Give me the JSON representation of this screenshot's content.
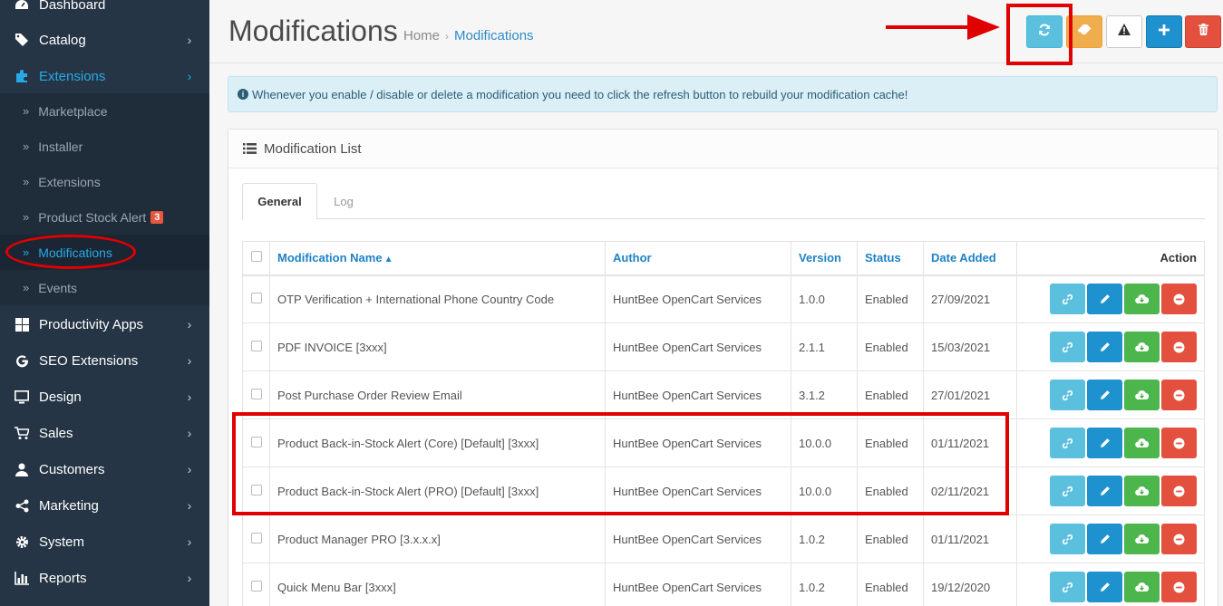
{
  "sidebar": {
    "items": [
      {
        "label": "Dashboard",
        "icon": "dashboard-icon"
      },
      {
        "label": "Catalog",
        "icon": "tags-icon"
      },
      {
        "label": "Extensions",
        "icon": "puzzle-icon"
      },
      {
        "label": "Productivity Apps",
        "icon": "windows-icon"
      },
      {
        "label": "SEO Extensions",
        "icon": "google-icon"
      },
      {
        "label": "Design",
        "icon": "monitor-icon"
      },
      {
        "label": "Sales",
        "icon": "cart-icon"
      },
      {
        "label": "Customers",
        "icon": "user-icon"
      },
      {
        "label": "Marketing",
        "icon": "share-icon"
      },
      {
        "label": "System",
        "icon": "gear-icon"
      },
      {
        "label": "Reports",
        "icon": "bar-chart-icon"
      }
    ],
    "submenu": [
      {
        "label": "Marketplace"
      },
      {
        "label": "Installer"
      },
      {
        "label": "Extensions"
      },
      {
        "label": "Product Stock Alert",
        "badge": "3"
      },
      {
        "label": "Modifications"
      },
      {
        "label": "Events"
      }
    ]
  },
  "header": {
    "title": "Modifications",
    "breadcrumb": [
      "Home",
      "Modifications"
    ],
    "separator": "›"
  },
  "alert": {
    "text": "Whenever you enable / disable or delete a modification you need to click the refresh button to rebuild your modification cache!"
  },
  "panel": {
    "title": "Modification List",
    "tabs": [
      "General",
      "Log"
    ]
  },
  "table": {
    "columns": [
      "Modification Name",
      "Author",
      "Version",
      "Status",
      "Date Added",
      "Action"
    ],
    "rows": [
      {
        "name": "OTP Verification + International Phone Country Code",
        "author": "HuntBee OpenCart Services",
        "version": "1.0.0",
        "status": "Enabled",
        "date": "27/09/2021"
      },
      {
        "name": "PDF INVOICE [3xxx]",
        "author": "HuntBee OpenCart Services",
        "version": "2.1.1",
        "status": "Enabled",
        "date": "15/03/2021"
      },
      {
        "name": "Post Purchase Order Review Email",
        "author": "HuntBee OpenCart Services",
        "version": "3.1.2",
        "status": "Enabled",
        "date": "27/01/2021"
      },
      {
        "name": "Product Back-in-Stock Alert (Core) [Default] [3xxx]",
        "author": "HuntBee OpenCart Services",
        "version": "10.0.0",
        "status": "Enabled",
        "date": "01/11/2021"
      },
      {
        "name": "Product Back-in-Stock Alert (PRO) [Default] [3xxx]",
        "author": "HuntBee OpenCart Services",
        "version": "10.0.0",
        "status": "Enabled",
        "date": "02/11/2021"
      },
      {
        "name": "Product Manager PRO [3.x.x.x]",
        "author": "HuntBee OpenCart Services",
        "version": "1.0.2",
        "status": "Enabled",
        "date": "01/11/2021"
      },
      {
        "name": "Quick Menu Bar [3xxx]",
        "author": "HuntBee OpenCart Services",
        "version": "1.0.2",
        "status": "Enabled",
        "date": "19/12/2020"
      }
    ]
  },
  "colors": {
    "sidebar_bg": "#253545",
    "accent": "#1e91cf",
    "info": "#5bc0de",
    "warning": "#f0ad4e",
    "success": "#4cb64c",
    "danger": "#e3503e",
    "annotation": "#e00000"
  }
}
